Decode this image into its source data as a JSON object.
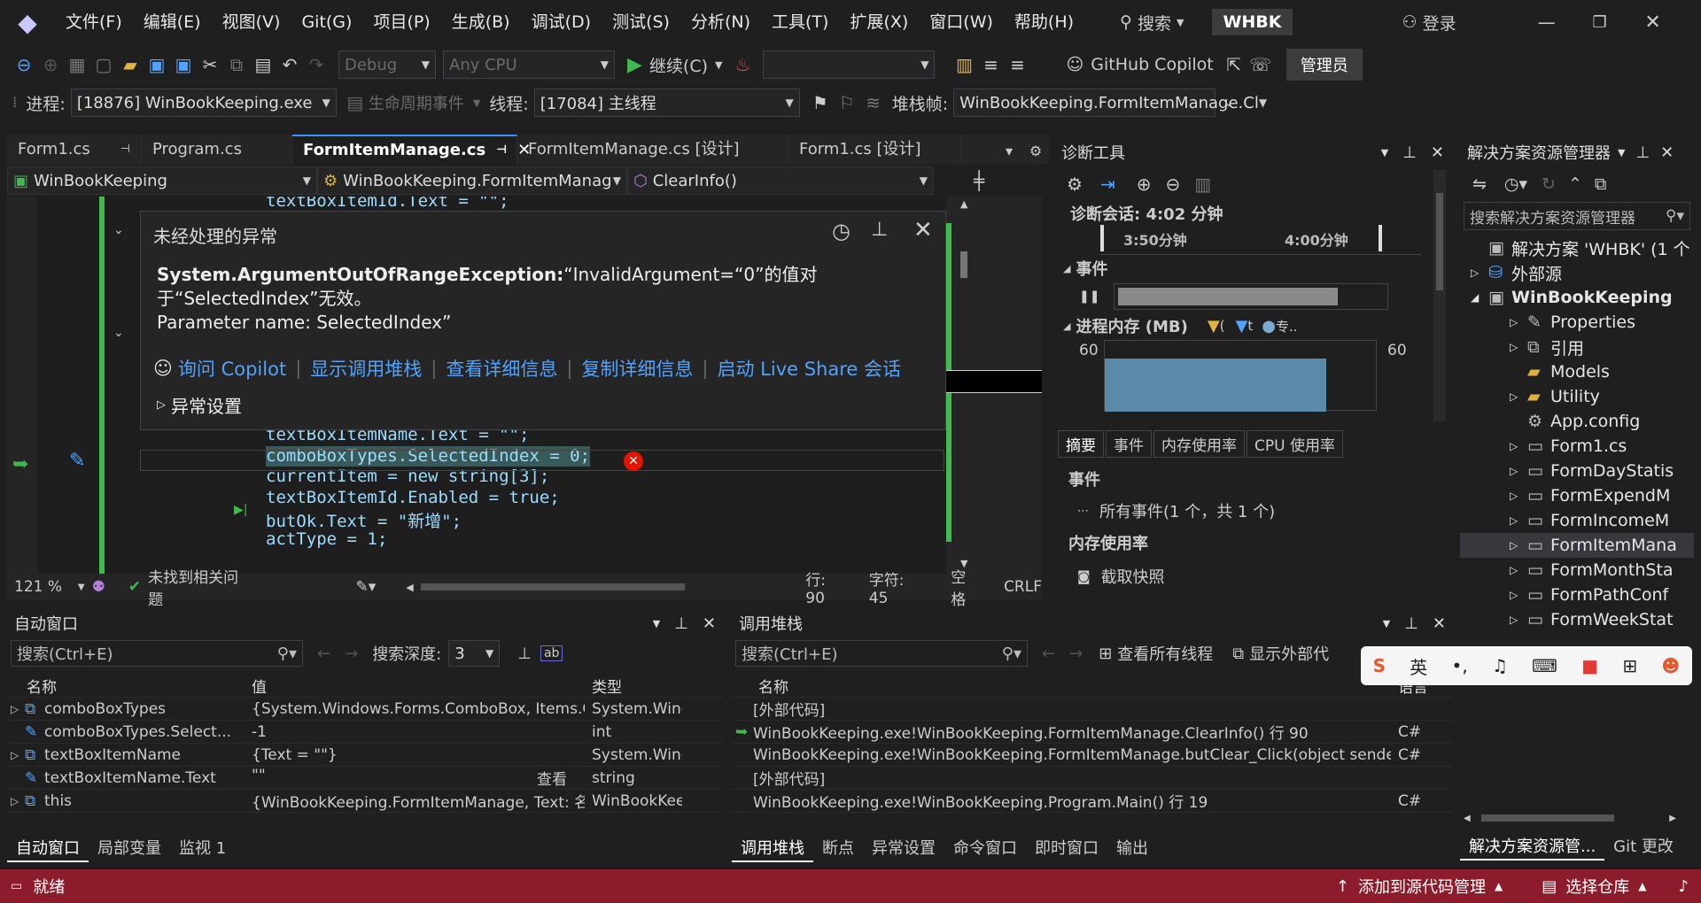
{
  "menu": [
    "文件(F)",
    "编辑(E)",
    "视图(V)",
    "Git(G)",
    "项目(P)",
    "生成(B)",
    "调试(D)",
    "测试(S)",
    "分析(N)",
    "工具(T)",
    "扩展(X)",
    "窗口(W)",
    "帮助(H)"
  ],
  "search_label": "搜索",
  "solution_badge": "WHBK",
  "login_label": "登录",
  "toolbar": {
    "config": "Debug",
    "platform": "Any CPU",
    "continue": "继续(C)",
    "copilot": "GitHub Copilot",
    "admin": "管理员"
  },
  "debugbar": {
    "process_label": "进程:",
    "process": "[18876] WinBookKeeping.exe",
    "lifecycle": "生命周期事件",
    "thread_label": "线程:",
    "thread": "[17084] 主线程",
    "stack_label": "堆栈帧:",
    "stack": "WinBookKeeping.FormItemManage.Cl"
  },
  "editor_tabs": [
    "Form1.cs",
    "Program.cs",
    "FormItemManage.cs",
    "FormItemManage.cs [设计]",
    "Form1.cs [设计]"
  ],
  "nav": {
    "project": "WinBookKeeping",
    "class": "WinBookKeeping.FormItemManag",
    "member": "ClearInfo()"
  },
  "code_lines": [
    {
      "text": "textBoxItemId.Text = \"\";",
      "hl": false
    },
    {
      "text": "textBoxItemName.Text = \"\";",
      "hl": false
    },
    {
      "text": "comboBoxTypes.SelectedIndex = 0;",
      "hl": true
    },
    {
      "text": "currentItem = new string[3];",
      "hl": false
    },
    {
      "text": "textBoxItemId.Enabled = true;",
      "hl": false
    },
    {
      "text": "butOk.Text = \"新增\";",
      "hl": false
    },
    {
      "text": "actType = 1;",
      "hl": false
    }
  ],
  "exception": {
    "title": "未经处理的异常",
    "type": "System.ArgumentOutOfRangeException:",
    "msg1": "“InvalidArgument=“0”的值对",
    "msg2": "于“SelectedIndex”无效。",
    "msg3": "Parameter name: SelectedIndex”",
    "links": [
      "询问 Copilot",
      "显示调用堆栈",
      "查看详细信息",
      "复制详细信息",
      "启动 Live Share 会话"
    ],
    "settings": "异常设置"
  },
  "status_editor": {
    "zoom": "121 %",
    "issues": "未找到相关问题",
    "line": "行: 90",
    "col": "字符: 45",
    "spaces": "空格",
    "eol": "CRLF"
  },
  "diag": {
    "title": "诊断工具",
    "session": "诊断会话: 4:02 分钟",
    "t1": "3:50分钟",
    "t2": "4:00分钟",
    "events": "事件",
    "memory": "进程内存 (MB)",
    "leg1": "(",
    "leg2": "t",
    "leg3": "专..",
    "ymax": "60",
    "ymax_r": "60",
    "tabs": [
      "摘要",
      "事件",
      "内存使用率",
      "CPU 使用率"
    ],
    "sec_events": "事件",
    "all_events": "所有事件(1 个，共 1 个)",
    "sec_mem": "内存使用率",
    "snapshot": "截取快照"
  },
  "solution": {
    "title": "解决方案资源管理器",
    "search": "搜索解决方案资源管理器",
    "items": [
      "解决方案 'WHBK' (1 个",
      "外部源",
      "WinBookKeeping",
      "Properties",
      "引用",
      "Models",
      "Utility",
      "App.config",
      "Form1.cs",
      "FormDayStatis",
      "FormExpendM",
      "FormIncomeM",
      "FormItemMana",
      "FormMonthSta",
      "FormPathConf",
      "FormWeekStat"
    ],
    "footer_tabs": [
      "解决方案资源管...",
      "Git 更改"
    ]
  },
  "autos": {
    "title": "自动窗口",
    "search": "搜索(Ctrl+E)",
    "depth_label": "搜索深度:",
    "depth": "3",
    "cols": [
      "名称",
      "值",
      "类型"
    ],
    "rows": [
      [
        "comboBoxTypes",
        "{System.Windows.Forms.ComboBox, Items.C...",
        "System.Wind..."
      ],
      [
        "comboBoxTypes.Select...",
        "-1",
        "int"
      ],
      [
        "textBoxItemName",
        "{Text = \"\"}",
        "System.Wind..."
      ],
      [
        "textBoxItemName.Text",
        "\"\"",
        "string"
      ],
      [
        "this",
        "{WinBookKeeping.FormItemManage, Text: 名...",
        "WinBookKee..."
      ]
    ],
    "view_label": "查看",
    "tabs": [
      "自动窗口",
      "局部变量",
      "监视 1"
    ]
  },
  "callstack": {
    "title": "调用堆栈",
    "search": "搜索(Ctrl+E)",
    "view_threads": "查看所有线程",
    "show_external": "显示外部代",
    "cols": [
      "名称",
      "语言"
    ],
    "rows": [
      [
        "[外部代码]",
        ""
      ],
      [
        "WinBookKeeping.exe!WinBookKeeping.FormItemManage.ClearInfo() 行 90",
        "C#"
      ],
      [
        "WinBookKeeping.exe!WinBookKeeping.FormItemManage.butClear_Click(object sender, S...",
        "C#"
      ],
      [
        "[外部代码]",
        ""
      ],
      [
        "WinBookKeeping.exe!WinBookKeeping.Program.Main() 行 19",
        "C#"
      ]
    ],
    "tabs": [
      "调用堆栈",
      "断点",
      "异常设置",
      "命令窗口",
      "即时窗口",
      "输出"
    ]
  },
  "ime": {
    "lang": "英"
  },
  "statusbar": {
    "ready": "就绪",
    "add_source": "添加到源代码管理",
    "select_repo": "选择仓库"
  },
  "colors": {
    "status_bg": "#8c1c2c",
    "accent": "#3794ff",
    "highlight": "#3a5a5a"
  }
}
